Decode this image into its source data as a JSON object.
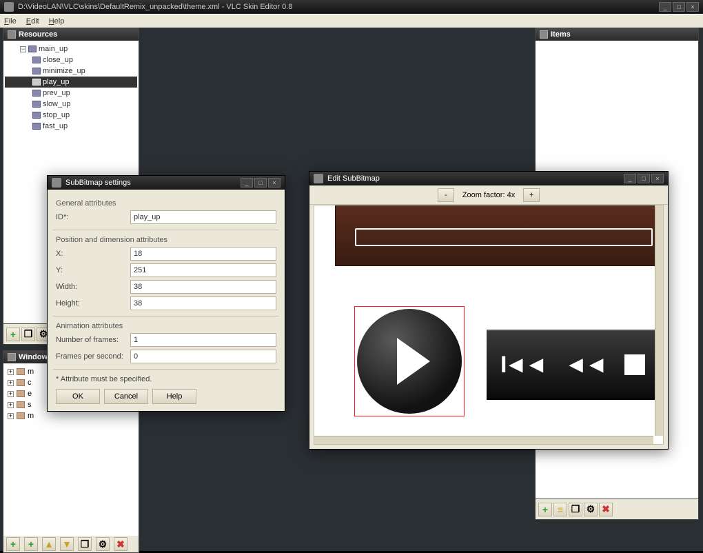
{
  "main": {
    "title": "D:\\VideoLAN\\VLC\\skins\\DefaultRemix_unpacked\\theme.xml - VLC Skin Editor 0.8"
  },
  "menu": {
    "file": "File",
    "edit": "Edit",
    "help": "Help"
  },
  "panels": {
    "resources": {
      "title": "Resources",
      "tree": {
        "root": "main_up",
        "items": [
          {
            "label": "close_up"
          },
          {
            "label": "minimize_up"
          },
          {
            "label": "play_up",
            "selected": true
          },
          {
            "label": "prev_up"
          },
          {
            "label": "slow_up"
          },
          {
            "label": "stop_up"
          },
          {
            "label": "fast_up"
          }
        ]
      }
    },
    "windows": {
      "title": "Windows",
      "items": [
        {
          "label": "m"
        },
        {
          "label": "c"
        },
        {
          "label": "e"
        },
        {
          "label": "s"
        },
        {
          "label": "m"
        }
      ]
    },
    "items": {
      "title": "Items"
    }
  },
  "dlg_settings": {
    "title": "SubBitmap settings",
    "groups": {
      "general": "General attributes",
      "posdim": "Position and dimension attributes",
      "anim": "Animation attributes"
    },
    "fields": {
      "id_label": "ID*:",
      "id_value": "play_up",
      "x_label": "X:",
      "x_value": "18",
      "y_label": "Y:",
      "y_value": "251",
      "w_label": "Width:",
      "w_value": "38",
      "h_label": "Height:",
      "h_value": "38",
      "frames_label": "Number of frames:",
      "frames_value": "1",
      "fps_label": "Frames per second:",
      "fps_value": "0"
    },
    "footnote": "* Attribute must be specified.",
    "buttons": {
      "ok": "OK",
      "cancel": "Cancel",
      "help": "Help"
    }
  },
  "dlg_edit": {
    "title": "Edit SubBitmap",
    "zoom_minus": "-",
    "zoom_label": "Zoom factor: 4x",
    "zoom_plus": "+"
  },
  "toolbar": {
    "add": "+",
    "dup": "=",
    "copy": "❐",
    "props": "⚙",
    "del": "✖"
  }
}
